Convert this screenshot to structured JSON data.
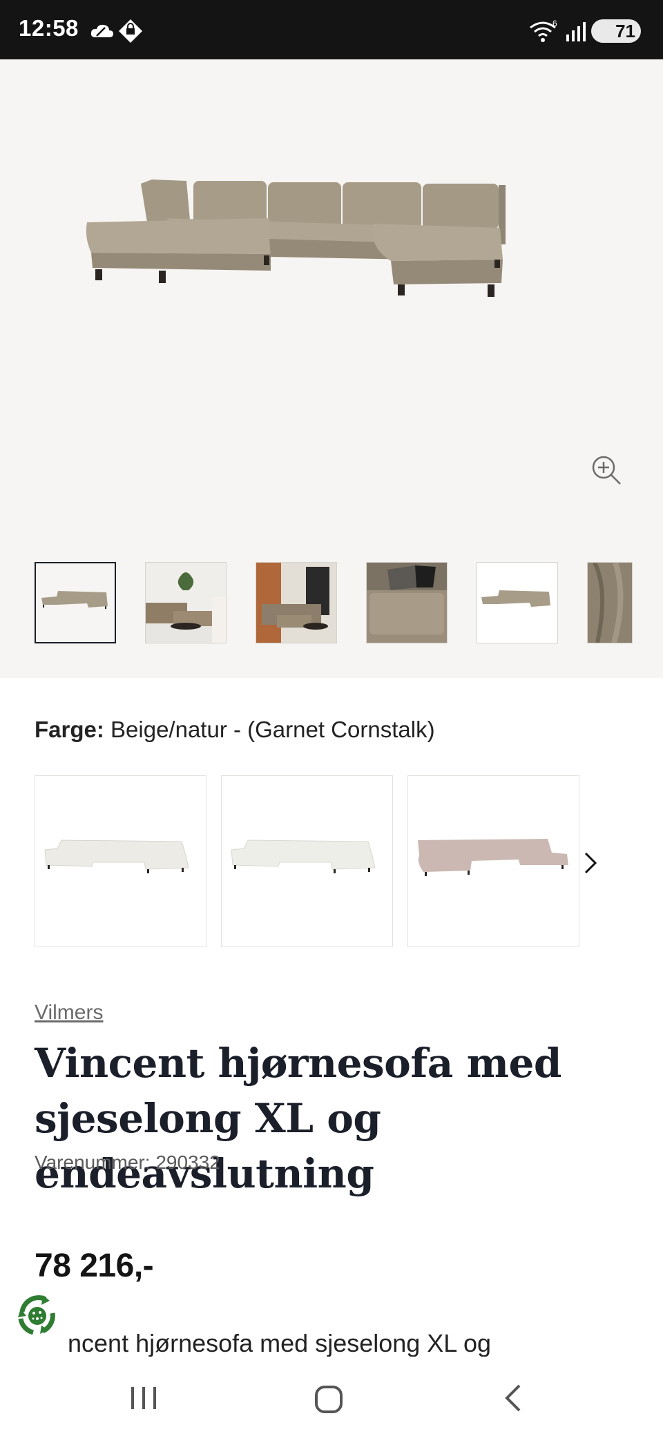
{
  "status_bar": {
    "time": "12:58",
    "battery": "71",
    "icons": [
      "cloud-icon",
      "vpn-shield-icon",
      "wifi-icon",
      "signal-icon",
      "battery-icon"
    ]
  },
  "gallery": {
    "main_image": "corner-sofa-u-shape-beige",
    "thumbnails": [
      {
        "name": "sofa-front-view",
        "active": true
      },
      {
        "name": "living-room-scene-1",
        "active": false
      },
      {
        "name": "living-room-scene-2",
        "active": false
      },
      {
        "name": "chaise-cushion-closeup",
        "active": false
      },
      {
        "name": "sofa-top-view",
        "active": false
      },
      {
        "name": "fabric-texture",
        "active": false
      }
    ]
  },
  "color": {
    "label": "Farge:",
    "value": "Beige/natur - (Garnet Cornstalk)",
    "variants": [
      {
        "name": "white-variant",
        "swatch": "#ecebe6"
      },
      {
        "name": "offwhite-variant",
        "swatch": "#eeeee9"
      },
      {
        "name": "pink-beige-variant",
        "swatch": "#cbb8b2"
      }
    ]
  },
  "product": {
    "brand": "Vilmers",
    "title": "Vincent hjørnesofa med sjeselong XL og endeavslutning",
    "sku": "Varenummer: 290332",
    "price": "78 216,-",
    "description_preview": "ncent hjørnesofa med sjeselong XL og"
  },
  "colors": {
    "sofa": "#a79c88",
    "sofa_dark": "#8f8574",
    "gallery_bg": "#f6f5f3",
    "title_color": "#1b1f2a",
    "recycle_green": "#2e7d32"
  }
}
